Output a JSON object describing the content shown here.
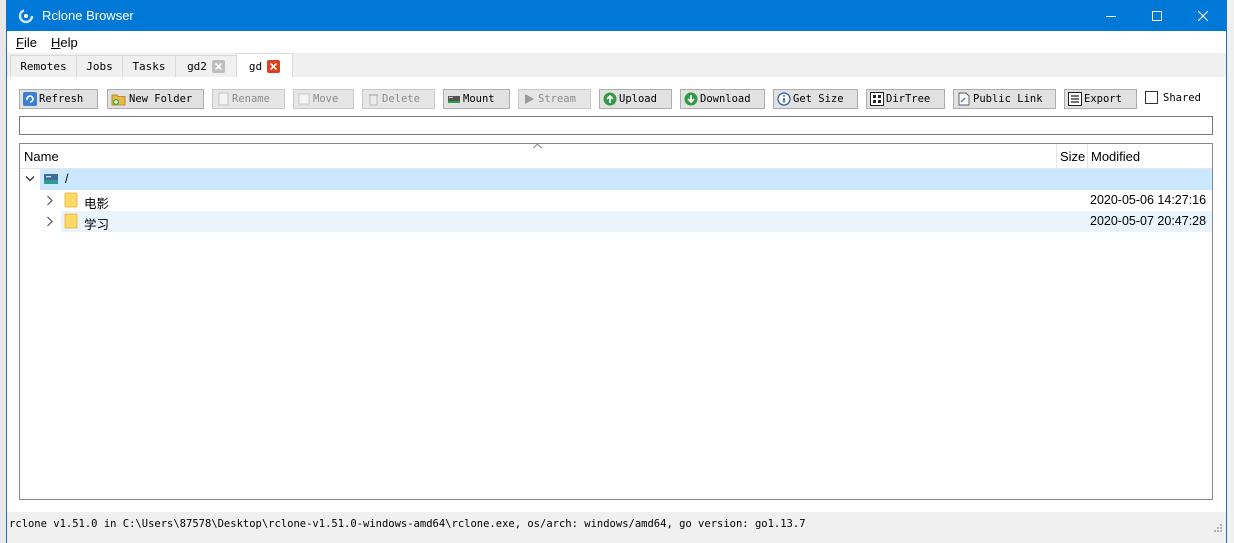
{
  "window": {
    "title": "Rclone Browser",
    "controls": [
      "minimize-icon",
      "maximize-icon",
      "close-icon"
    ]
  },
  "menu": [
    {
      "label": "File",
      "mnemonic": "F",
      "rest": "ile"
    },
    {
      "label": "Help",
      "mnemonic": "H",
      "rest": "elp"
    }
  ],
  "tabs": [
    {
      "label": "Remotes",
      "closable": false
    },
    {
      "label": "Jobs",
      "closable": false
    },
    {
      "label": "Tasks",
      "closable": false
    },
    {
      "label": "gd2",
      "closable": true
    },
    {
      "label": "gd",
      "closable": true,
      "active": true
    }
  ],
  "toolbar": {
    "refresh": "Refresh",
    "new_folder": "New Folder",
    "rename": "Rename",
    "move": "Move",
    "delete": "Delete",
    "mount": "Mount",
    "stream": "Stream",
    "upload": "Upload",
    "download": "Download",
    "get_size": "Get Size",
    "dirtree": "DirTree",
    "public_link": "Public Link",
    "export": "Export",
    "shared_label": "Shared",
    "shared_checked": false
  },
  "filter": {
    "value": ""
  },
  "tree": {
    "columns": {
      "name": "Name",
      "size": "Size",
      "modified": "Modified"
    },
    "root": {
      "label": "/",
      "expanded": true
    },
    "rows": [
      {
        "name": "电影",
        "size": "",
        "modified": "2020-05-06 14:27:16"
      },
      {
        "name": "学习",
        "size": "",
        "modified": "2020-05-07 20:47:28"
      }
    ]
  },
  "status": "rclone v1.51.0 in C:\\Users\\87578\\Desktop\\rclone-v1.51.0-windows-amd64\\rclone.exe, os/arch: windows/amd64, go version: go1.13.7",
  "colors": {
    "titlebar": "#0078d7",
    "selection": "#cce8ff",
    "tab_close": "#e0401c"
  }
}
